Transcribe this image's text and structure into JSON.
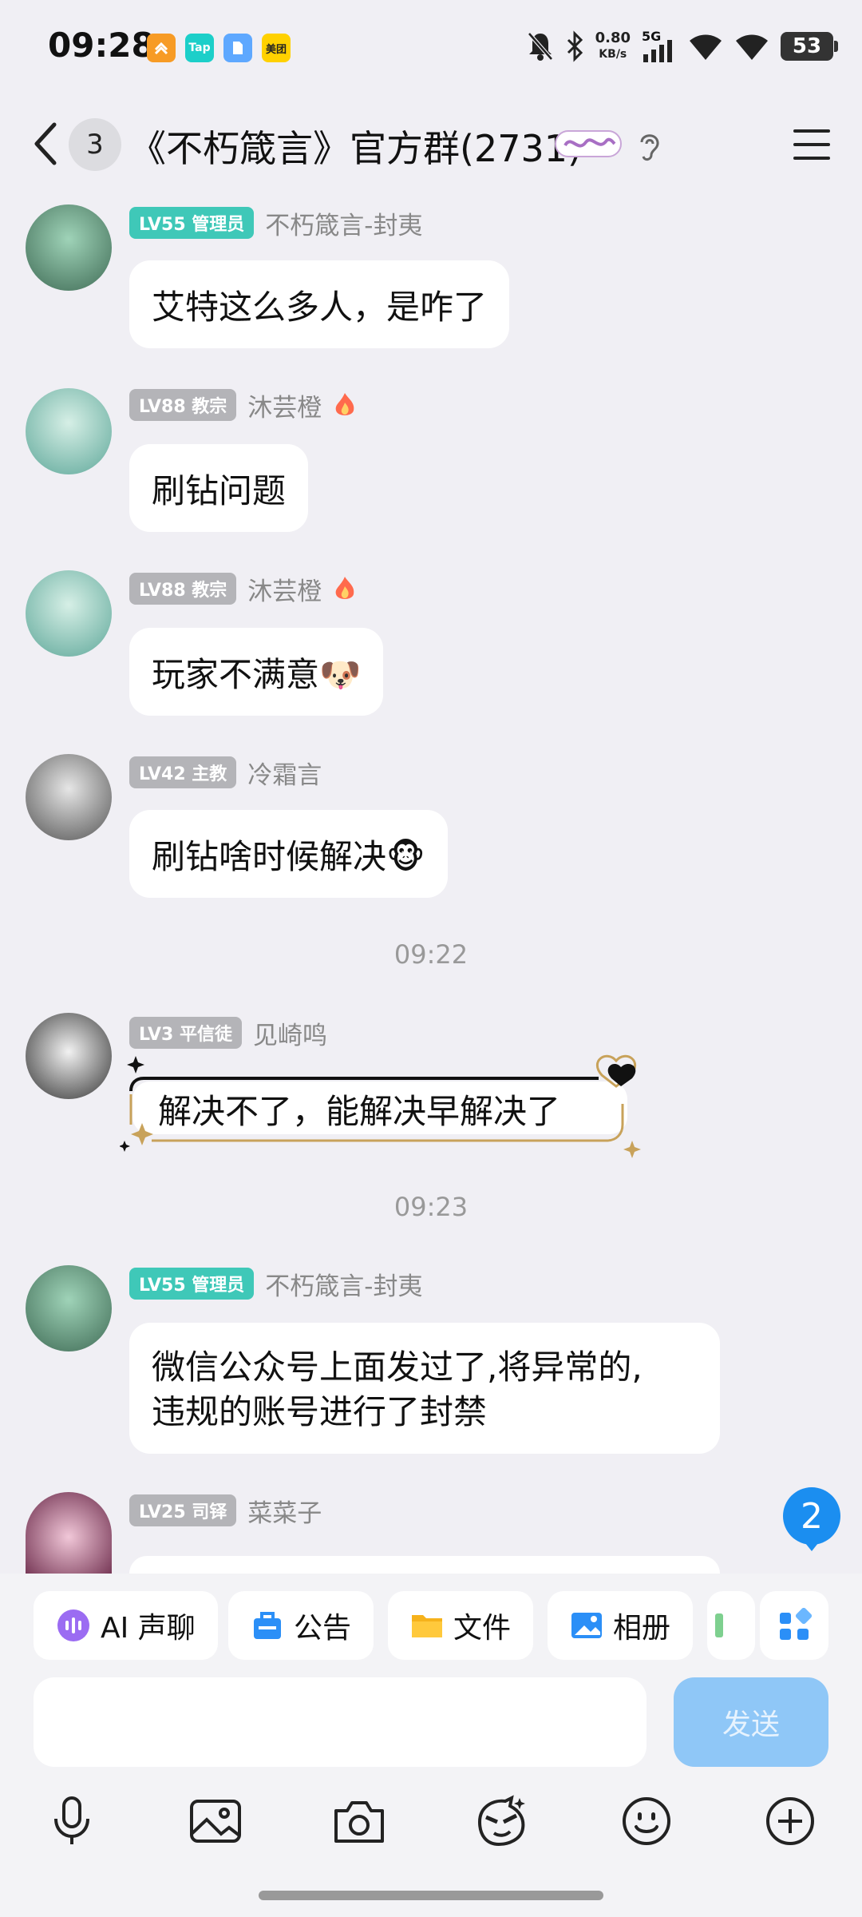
{
  "status_bar": {
    "time": "09:28",
    "apps": [
      {
        "name": "app-icon-1",
        "label": "",
        "color": "#f79b25"
      },
      {
        "name": "taptap-icon",
        "label": "Tap",
        "color": "#1ccfc9"
      },
      {
        "name": "app-icon-3",
        "label": "",
        "color": "#5ea8ff"
      },
      {
        "name": "meituan-icon",
        "label": "美团",
        "color": "#ffd100"
      }
    ],
    "net_speed_value": "0.80",
    "net_speed_unit": "KB/s",
    "network": "5G",
    "battery": "53"
  },
  "header": {
    "unread_count": "3",
    "title": "《不朽箴言》官方群(2731)"
  },
  "messages": [
    {
      "badge": "LV55 管理员",
      "badge_type": "admin",
      "nick": "不朽箴言-封夷",
      "text": "艾特这么多人，是咋了",
      "avatar_colors": [
        "#3f6b55",
        "#9fd3b8"
      ]
    },
    {
      "badge": "LV88 教宗",
      "badge_type": "gray",
      "nick": "沐芸橙",
      "text": "刷钻问题",
      "avatar_colors": [
        "#5fa89a",
        "#d6efe6"
      ]
    },
    {
      "badge": "LV88 教宗",
      "badge_type": "gray",
      "nick": "沐芸橙",
      "text": "玩家不满意🐶",
      "avatar_colors": [
        "#5fa89a",
        "#d6efe6"
      ]
    },
    {
      "badge": "LV42 主教",
      "badge_type": "gray",
      "nick": "冷霜言",
      "text": "刷钻啥时候解决🐵",
      "avatar_colors": [
        "#555555",
        "#e6e6e6"
      ]
    },
    {
      "badge": "LV3 平信徒",
      "badge_type": "gray",
      "nick": "见崎鸣",
      "text": "解决不了，能解决早解决了",
      "avatar_colors": [
        "#333333",
        "#f2f2f2"
      ]
    },
    {
      "badge": "LV55 管理员",
      "badge_type": "admin",
      "nick": "不朽箴言-封夷",
      "text_lines": [
        "微信公众号上面发过了,将异常的,",
        "违规的账号进行了封禁"
      ],
      "avatar_colors": [
        "#3f6b55",
        "#9fd3b8"
      ]
    },
    {
      "badge": "LV25 司铎",
      "badge_type": "gray",
      "nick": "菜菜子",
      "text": "",
      "avatar_colors": [
        "#6b2a4a",
        "#f1c7d8"
      ]
    }
  ],
  "timestamps": [
    "09:22",
    "09:23"
  ],
  "new_message_count": "2",
  "quick_actions": [
    {
      "label": "AI 声聊",
      "icon": "ai-voice-icon"
    },
    {
      "label": "公告",
      "icon": "announcement-icon"
    },
    {
      "label": "文件",
      "icon": "folder-icon"
    },
    {
      "label": "相册",
      "icon": "album-icon"
    }
  ],
  "input": {
    "placeholder": "",
    "send_label": "发送"
  },
  "colors": {
    "admin_badge": "#3fc8b8",
    "level_badge": "#b4b4b8",
    "send_disabled": "#8fc7f7",
    "new_message_badge": "#1b8ef0"
  }
}
